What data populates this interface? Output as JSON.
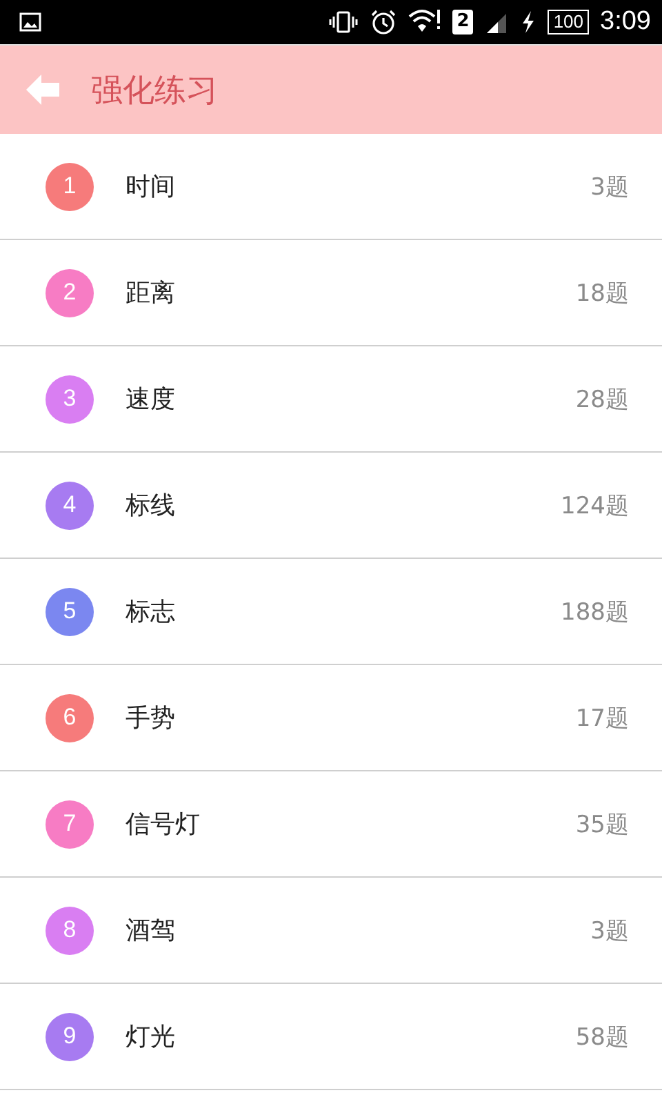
{
  "status_bar": {
    "sim": "2",
    "battery": "100",
    "time": "3:09"
  },
  "header": {
    "title": "强化练习"
  },
  "items": [
    {
      "number": "1",
      "name": "时间",
      "count": "3题",
      "color": "#f67b7b"
    },
    {
      "number": "2",
      "name": "距离",
      "count": "18题",
      "color": "#f77cc4"
    },
    {
      "number": "3",
      "name": "速度",
      "count": "28题",
      "color": "#d97ef2"
    },
    {
      "number": "4",
      "name": "标线",
      "count": "124题",
      "color": "#a77bf1"
    },
    {
      "number": "5",
      "name": "标志",
      "count": "188题",
      "color": "#7b87f0"
    },
    {
      "number": "6",
      "name": "手势",
      "count": "17题",
      "color": "#f67b7b"
    },
    {
      "number": "7",
      "name": "信号灯",
      "count": "35题",
      "color": "#f77cc4"
    },
    {
      "number": "8",
      "name": "酒驾",
      "count": "3题",
      "color": "#d97ef2"
    },
    {
      "number": "9",
      "name": "灯光",
      "count": "58题",
      "color": "#a77bf1"
    }
  ]
}
